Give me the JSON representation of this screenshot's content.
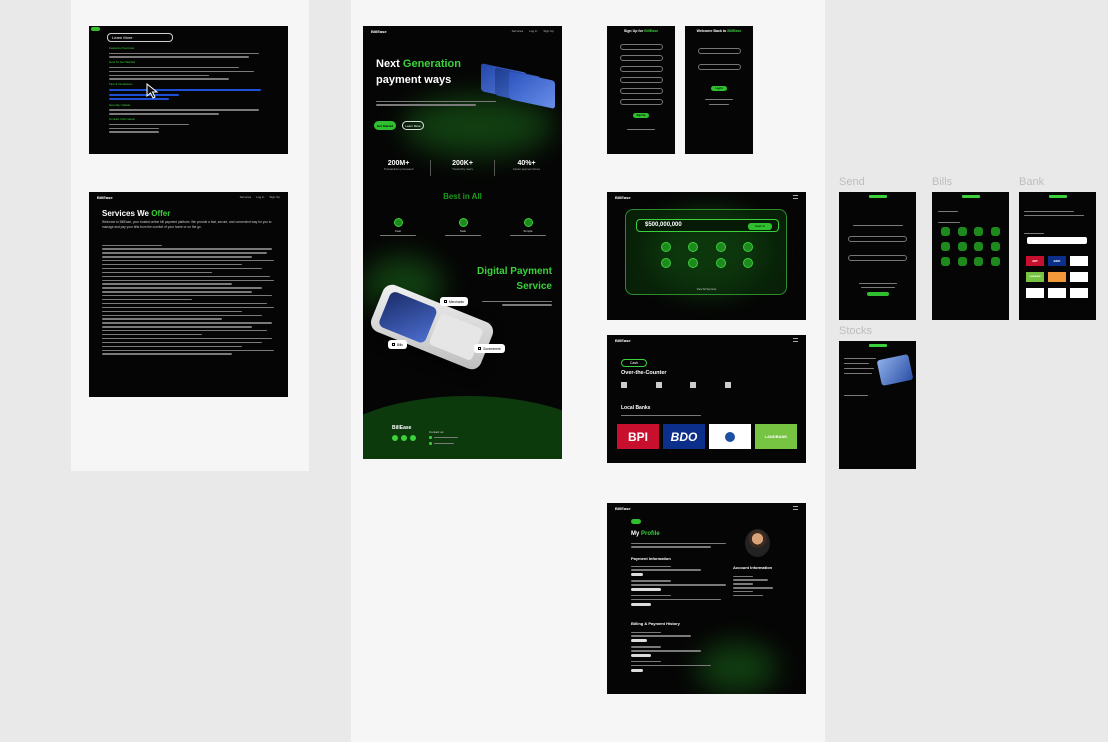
{
  "frames": {
    "learn": {
      "title": "Learn More",
      "title_accent": "More",
      "sections": [
        "Features Overview",
        "How To Get Started",
        "Tips & Guidelines",
        "Security Update",
        "Contact Information"
      ]
    },
    "services": {
      "brand": "BillEase",
      "nav": [
        "Services",
        "Log in",
        "Sign Up"
      ],
      "heading_pre": "Services We ",
      "heading_accent": "Offer",
      "intro": "Welcome to BillEase, your trusted online bill payment platform. We provide a fast, secure, and convenient way for you to manage and pay your bills from the comfort of your home or on the go."
    },
    "landing": {
      "brand": "BillEase",
      "nav": [
        "Services",
        "Log in",
        "Sign Up"
      ],
      "hero_line1_pre": "Next ",
      "hero_line1_accent": "Generation",
      "hero_line2": "payment ways",
      "btn_primary": "Get Started",
      "btn_secondary": "Learn More",
      "stats": [
        {
          "value": "200M+",
          "label": "Transactions processed"
        },
        {
          "value": "200K+",
          "label": "Trusted by users"
        },
        {
          "value": "40%+",
          "label": "Faster payment times"
        }
      ],
      "best_heading": "Best in All",
      "features": [
        "Fast",
        "Safe",
        "Simple"
      ],
      "digital_line1": "Digital Payment",
      "digital_line2": "Service",
      "chip_merchants": "Merchants",
      "chip_bills": "Bills",
      "chip_government": "Government",
      "footer_brand": "BillEase",
      "footer_contact": "Contact us"
    },
    "signup": {
      "title_pre": "Sign Up for ",
      "title_accent": "BillEase",
      "btn": "Sign Up"
    },
    "welcome": {
      "title_pre": "Welcome Back to ",
      "title_accent": "BillEase",
      "btn": "Log In"
    },
    "dashboard": {
      "brand": "BillEase",
      "balance": "$500,000,000",
      "cash_in": "Cash In",
      "footer_link": "View All Services"
    },
    "otc": {
      "brand": "BillEase",
      "cash_label": "Cash",
      "heading": "Over-the-Counter",
      "local_banks": "Local Banks",
      "banks": [
        "BPI",
        "BDO",
        "LANDBANK"
      ]
    },
    "profile": {
      "brand": "BillEase",
      "heading_pre": "My ",
      "heading_accent": "Profile",
      "payment_info": "Payment Information",
      "account_info": "Account Information",
      "billing_history": "Billing & Payment History"
    },
    "labels": {
      "send": "Send",
      "bills": "Bills",
      "bank": "Bank",
      "stocks": "Stocks"
    },
    "bank_mobile": {
      "banks": [
        "BPI",
        "BDO",
        "LANDBANK"
      ]
    },
    "colors": {
      "accent": "#3bd13b",
      "background": "#050505",
      "canvas": "#e9e9e9",
      "bpi": "#c8102e",
      "bdo": "#0b2f8a",
      "landbank": "#76c442"
    }
  }
}
